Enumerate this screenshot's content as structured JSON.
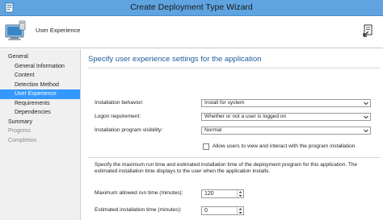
{
  "window": {
    "title": "Create Deployment Type Wizard"
  },
  "header": {
    "page_name": "User Experience",
    "wizard_icon": "computer-icon",
    "help_icon": "help-icon"
  },
  "sidebar": {
    "items": [
      {
        "label": "General",
        "level": 0,
        "state": "normal"
      },
      {
        "label": "General Information",
        "level": 1,
        "state": "normal"
      },
      {
        "label": "Content",
        "level": 1,
        "state": "normal"
      },
      {
        "label": "Detection Method",
        "level": 1,
        "state": "normal"
      },
      {
        "label": "User Experience",
        "level": 1,
        "state": "selected"
      },
      {
        "label": "Requirements",
        "level": 1,
        "state": "normal"
      },
      {
        "label": "Dependencies",
        "level": 1,
        "state": "normal"
      },
      {
        "label": "Summary",
        "level": 0,
        "state": "normal"
      },
      {
        "label": "Progress",
        "level": 0,
        "state": "disabled"
      },
      {
        "label": "Completion",
        "level": 0,
        "state": "disabled"
      }
    ]
  },
  "main": {
    "title": "Specify user experience settings for the application",
    "installation_behavior": {
      "label": "Installation behavior:",
      "value": "Install for system"
    },
    "logon_requirement": {
      "label": "Logon requirement:",
      "value": "Whether or not a user is logged on"
    },
    "program_visibility": {
      "label": "Installation program visibility:",
      "value": "Normal"
    },
    "allow_interact": {
      "label": "Allow users to view and interact with the program installation",
      "checked": false
    },
    "description": "Specify the maximum run time and estimated installation time of the deployment program for this application. The estimated installation time displays to the user when the application installs.",
    "max_run_time": {
      "label": "Maximum allowed run time (minutes):",
      "value": "120"
    },
    "est_install_time": {
      "label": "Estimated installation time (minutes):",
      "value": "0"
    }
  },
  "colors": {
    "title_bar": "#5fa4e0",
    "selection": "#3399ff",
    "page_title": "#1f5c99",
    "sidebar_bg": "#f0f0f0"
  }
}
